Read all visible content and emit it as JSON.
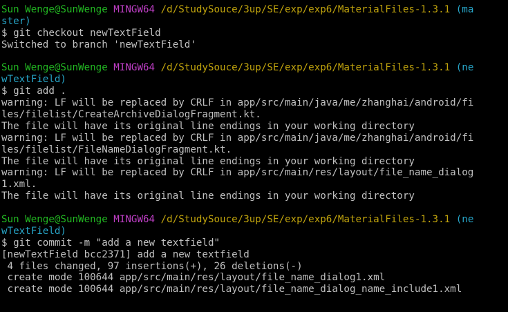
{
  "palette": {
    "background": "#000000",
    "text": "#c0c0c0",
    "user_host": "#22b822",
    "env": "#c03fc7",
    "path": "#c1a40d",
    "branch": "#27a5c8"
  },
  "terminal": {
    "lines": [
      {
        "segments": [
          {
            "text": "Sun Wenge@SunWenge ",
            "color": "green"
          },
          {
            "text": "MINGW64 ",
            "color": "magenta"
          },
          {
            "text": "/d/StudySouce/3up/SE/exp/exp6/MaterialFiles-1.3.1 ",
            "color": "yellow"
          },
          {
            "text": "(ma",
            "color": "cyan"
          }
        ]
      },
      {
        "segments": [
          {
            "text": "ster)",
            "color": "cyan"
          }
        ]
      },
      {
        "segments": [
          {
            "text": "$ git checkout newTextField",
            "color": "white"
          }
        ]
      },
      {
        "segments": [
          {
            "text": "Switched to branch 'newTextField'",
            "color": "white"
          }
        ]
      },
      {
        "segments": []
      },
      {
        "segments": [
          {
            "text": "Sun Wenge@SunWenge ",
            "color": "green"
          },
          {
            "text": "MINGW64 ",
            "color": "magenta"
          },
          {
            "text": "/d/StudySouce/3up/SE/exp/exp6/MaterialFiles-1.3.1 ",
            "color": "yellow"
          },
          {
            "text": "(ne",
            "color": "cyan"
          }
        ]
      },
      {
        "segments": [
          {
            "text": "wTextField)",
            "color": "cyan"
          }
        ]
      },
      {
        "segments": [
          {
            "text": "$ git add .",
            "color": "white"
          }
        ]
      },
      {
        "segments": [
          {
            "text": "warning: LF will be replaced by CRLF in app/src/main/java/me/zhanghai/android/fi",
            "color": "white"
          }
        ]
      },
      {
        "segments": [
          {
            "text": "les/filelist/CreateArchiveDialogFragment.kt.",
            "color": "white"
          }
        ]
      },
      {
        "segments": [
          {
            "text": "The file will have its original line endings in your working directory",
            "color": "white"
          }
        ]
      },
      {
        "segments": [
          {
            "text": "warning: LF will be replaced by CRLF in app/src/main/java/me/zhanghai/android/fi",
            "color": "white"
          }
        ]
      },
      {
        "segments": [
          {
            "text": "les/filelist/FileNameDialogFragment.kt.",
            "color": "white"
          }
        ]
      },
      {
        "segments": [
          {
            "text": "The file will have its original line endings in your working directory",
            "color": "white"
          }
        ]
      },
      {
        "segments": [
          {
            "text": "warning: LF will be replaced by CRLF in app/src/main/res/layout/file_name_dialog",
            "color": "white"
          }
        ]
      },
      {
        "segments": [
          {
            "text": "1.xml.",
            "color": "white"
          }
        ]
      },
      {
        "segments": [
          {
            "text": "The file will have its original line endings in your working directory",
            "color": "white"
          }
        ]
      },
      {
        "segments": []
      },
      {
        "segments": [
          {
            "text": "Sun Wenge@SunWenge ",
            "color": "green"
          },
          {
            "text": "MINGW64 ",
            "color": "magenta"
          },
          {
            "text": "/d/StudySouce/3up/SE/exp/exp6/MaterialFiles-1.3.1 ",
            "color": "yellow"
          },
          {
            "text": "(ne",
            "color": "cyan"
          }
        ]
      },
      {
        "segments": [
          {
            "text": "wTextField)",
            "color": "cyan"
          }
        ]
      },
      {
        "segments": [
          {
            "text": "$ git commit -m \"add a new textfield\"",
            "color": "white"
          }
        ]
      },
      {
        "segments": [
          {
            "text": "[newTextField bcc2371] add a new textfield",
            "color": "white"
          }
        ]
      },
      {
        "segments": [
          {
            "text": " 4 files changed, 97 insertions(+), 26 deletions(-)",
            "color": "white"
          }
        ]
      },
      {
        "segments": [
          {
            "text": " create mode 100644 app/src/main/res/layout/file_name_dialog1.xml",
            "color": "white"
          }
        ]
      },
      {
        "segments": [
          {
            "text": " create mode 100644 app/src/main/res/layout/file_name_dialog_name_include1.xml",
            "color": "white"
          }
        ]
      }
    ]
  }
}
